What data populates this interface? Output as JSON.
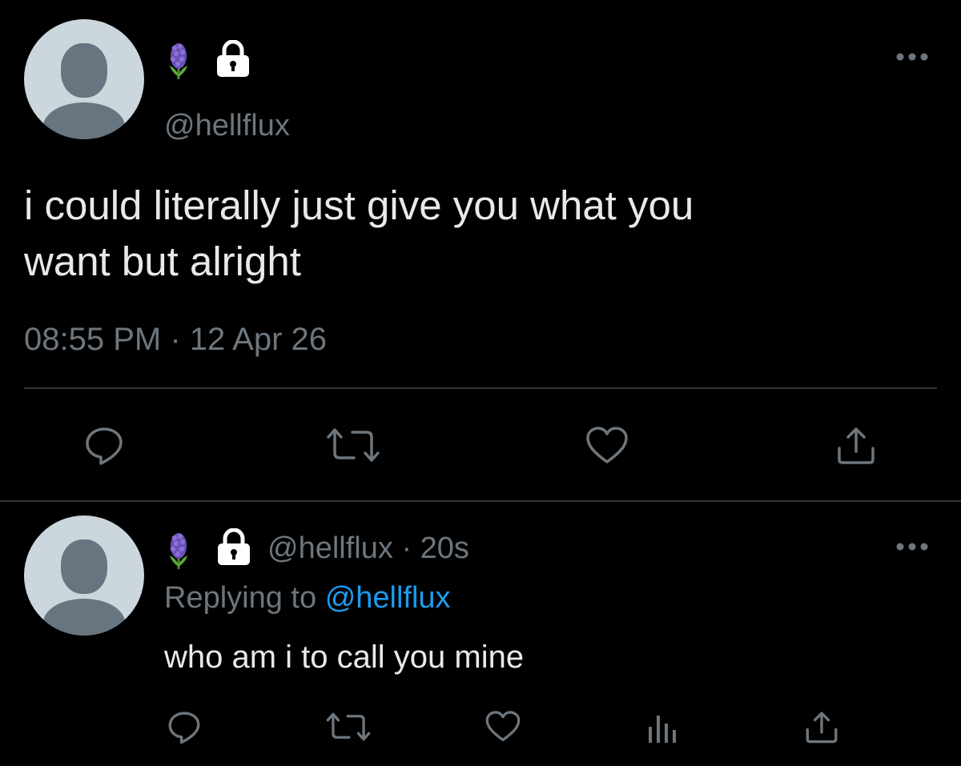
{
  "main_tweet": {
    "avatar_icon": "default-avatar-icon",
    "name_icons": [
      "hyacinth-emoji-icon",
      "lock-icon"
    ],
    "handle": "@hellflux",
    "text_line1": "i could literally just give you what you",
    "text_line2": "want but alright",
    "timestamp": "08:55 PM · 12 Apr 26",
    "more_icon": "more-dots-icon",
    "actions": [
      "reply-icon",
      "retweet-icon",
      "like-icon",
      "share-icon"
    ]
  },
  "reply_tweet": {
    "avatar_icon": "default-avatar-icon",
    "name_icons": [
      "hyacinth-emoji-icon",
      "lock-icon"
    ],
    "handle": "@hellflux",
    "time": "· 20s",
    "replying_prefix": "Replying to",
    "replying_handle": "@hellflux",
    "text": "who am i to call you mine",
    "more_icon": "more-dots-icon",
    "actions": [
      "reply-icon",
      "retweet-icon",
      "like-icon",
      "analytics-icon",
      "share-icon"
    ]
  },
  "colors": {
    "background": "#000000",
    "text": "#e7e9ea",
    "muted": "#6e767d",
    "link": "#1d9bf0",
    "avatar_bg": "#ccd6dd",
    "avatar_fg": "#66757f"
  }
}
